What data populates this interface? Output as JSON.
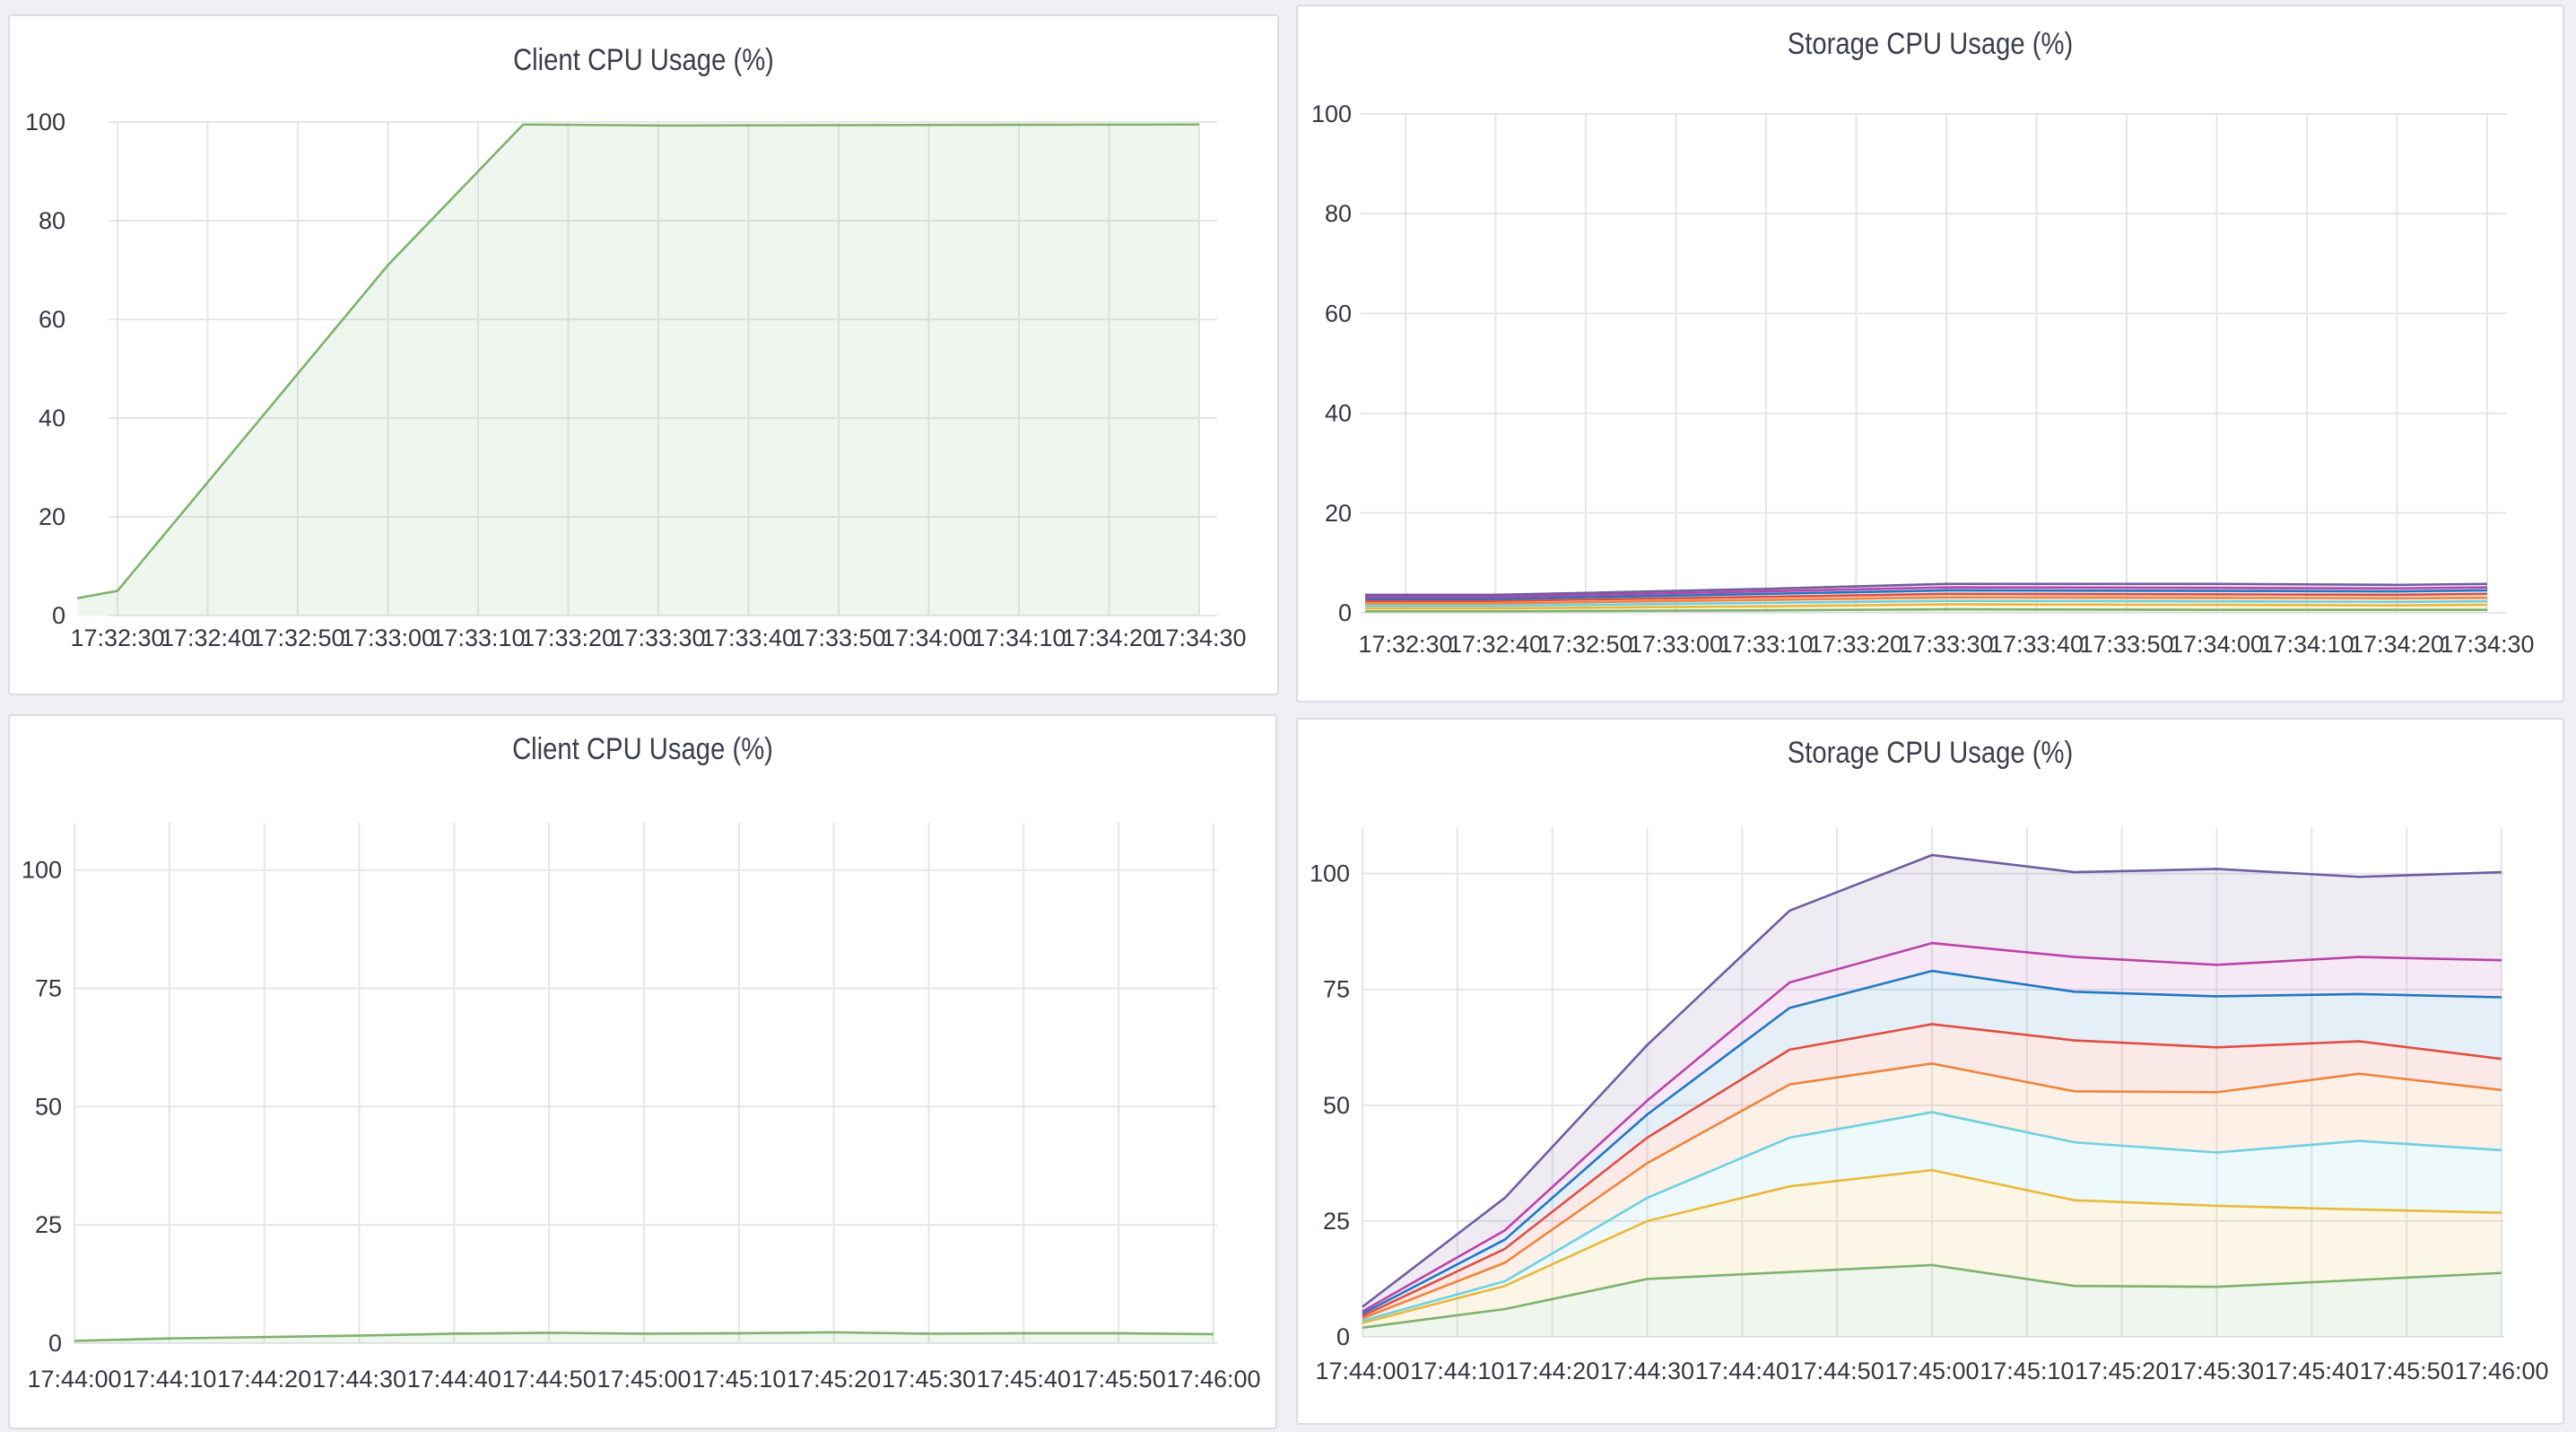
{
  "chart_data": [
    {
      "type": "area",
      "title": "Client CPU Usage (%)",
      "xlabel": "",
      "ylabel": "",
      "ylim": [
        0,
        100
      ],
      "y_ticks": [
        "0",
        "20",
        "40",
        "60",
        "80",
        "100"
      ],
      "x_ticks": [
        "17:32:30",
        "17:32:40",
        "17:32:50",
        "17:33:00",
        "17:33:10",
        "17:33:20",
        "17:33:30",
        "17:33:40",
        "17:33:50",
        "17:34:00",
        "17:34:10",
        "17:34:20",
        "17:34:30"
      ],
      "grid": true,
      "x": [
        "17:32:25",
        "17:32:30",
        "17:33:00",
        "17:33:15",
        "17:33:30",
        "17:34:30"
      ],
      "series": [
        {
          "values": [
            3.5,
            5,
            71,
            99.5,
            99.3,
            99.5
          ],
          "color": "#7eb26d"
        }
      ]
    },
    {
      "type": "area",
      "title": "Storage CPU Usage (%)",
      "xlabel": "",
      "ylabel": "",
      "ylim": [
        0,
        100
      ],
      "y_ticks": [
        "0",
        "20",
        "40",
        "60",
        "80",
        "100"
      ],
      "x_ticks": [
        "17:32:30",
        "17:32:40",
        "17:32:50",
        "17:33:00",
        "17:33:10",
        "17:33:20",
        "17:33:30",
        "17:33:40",
        "17:33:50",
        "17:34:00",
        "17:34:10",
        "17:34:20",
        "17:34:30"
      ],
      "grid": true,
      "x": [
        "17:32:25",
        "17:32:40",
        "17:33:10",
        "17:33:30",
        "17:34:00",
        "17:34:20",
        "17:34:30"
      ],
      "series": [
        {
          "values": [
            0.3,
            0.3,
            0.5,
            0.7,
            0.6,
            0.6,
            0.6
          ],
          "color": "#7eb26d"
        },
        {
          "values": [
            0.9,
            0.9,
            1.3,
            1.7,
            1.6,
            1.5,
            1.6
          ],
          "color": "#eab839"
        },
        {
          "values": [
            1.4,
            1.4,
            2.0,
            2.4,
            2.3,
            2.2,
            2.3
          ],
          "color": "#6ed0e0"
        },
        {
          "values": [
            1.9,
            1.9,
            2.6,
            3.1,
            3.0,
            2.9,
            3.0
          ],
          "color": "#ef843c"
        },
        {
          "values": [
            2.4,
            2.4,
            3.2,
            3.8,
            3.7,
            3.6,
            3.8
          ],
          "color": "#e24d42"
        },
        {
          "values": [
            2.8,
            2.8,
            3.8,
            4.5,
            4.4,
            4.3,
            4.5
          ],
          "color": "#1f78c1"
        },
        {
          "values": [
            3.2,
            3.2,
            4.3,
            5.1,
            5.0,
            4.9,
            5.1
          ],
          "color": "#ba43a9"
        },
        {
          "values": [
            3.6,
            3.6,
            4.8,
            5.8,
            5.8,
            5.6,
            5.8
          ],
          "color": "#705da0"
        }
      ]
    },
    {
      "type": "area",
      "title": "Client CPU Usage (%)",
      "xlabel": "",
      "ylabel": "",
      "ylim": [
        0,
        110
      ],
      "y_ticks": [
        "0",
        "25",
        "50",
        "75",
        "100"
      ],
      "x_ticks": [
        "17:44:00",
        "17:44:10",
        "17:44:20",
        "17:44:30",
        "17:44:40",
        "17:44:50",
        "17:45:00",
        "17:45:10",
        "17:45:20",
        "17:45:30",
        "17:45:40",
        "17:45:50",
        "17:46:00"
      ],
      "grid": true,
      "x": [
        "17:44:00",
        "17:44:10",
        "17:44:20",
        "17:44:30",
        "17:44:40",
        "17:44:50",
        "17:45:00",
        "17:45:10",
        "17:45:20",
        "17:45:30",
        "17:45:40",
        "17:45:50",
        "17:46:00"
      ],
      "series": [
        {
          "values": [
            0.5,
            1.0,
            1.3,
            1.6,
            2.0,
            2.2,
            2.0,
            2.1,
            2.3,
            2.0,
            2.1,
            2.1,
            1.9
          ],
          "color": "#7eb26d"
        }
      ]
    },
    {
      "type": "area",
      "title": "Storage CPU Usage (%)",
      "xlabel": "",
      "ylabel": "",
      "ylim": [
        0,
        110
      ],
      "y_ticks": [
        "0",
        "25",
        "50",
        "75",
        "100"
      ],
      "x_ticks": [
        "17:44:00",
        "17:44:10",
        "17:44:20",
        "17:44:30",
        "17:44:40",
        "17:44:50",
        "17:45:00",
        "17:45:10",
        "17:45:20",
        "17:45:30",
        "17:45:40",
        "17:45:50",
        "17:46:00"
      ],
      "grid": true,
      "x": [
        "17:44:00",
        "17:44:15",
        "17:44:30",
        "17:44:45",
        "17:45:00",
        "17:45:15",
        "17:45:30",
        "17:45:45",
        "17:46:00"
      ],
      "series": [
        {
          "values": [
            2,
            6,
            12.5,
            14,
            15.5,
            11,
            10.8,
            12.3,
            13.8
          ],
          "color": "#7eb26d"
        },
        {
          "values": [
            3,
            11,
            25,
            32.5,
            36,
            29.5,
            28.3,
            27.5,
            26.8
          ],
          "color": "#eab839"
        },
        {
          "values": [
            3.5,
            12,
            30,
            43,
            48.5,
            42,
            39.8,
            42.3,
            40.3
          ],
          "color": "#6ed0e0"
        },
        {
          "values": [
            4,
            16,
            37.5,
            54.5,
            59,
            53,
            52.8,
            56.8,
            53.3
          ],
          "color": "#ef843c"
        },
        {
          "values": [
            4.5,
            19,
            43,
            62,
            67.5,
            64,
            62.5,
            63.8,
            60
          ],
          "color": "#e24d42"
        },
        {
          "values": [
            5,
            21,
            48,
            71,
            79,
            74.5,
            73.5,
            74,
            73.3
          ],
          "color": "#1f78c1"
        },
        {
          "values": [
            5.5,
            23,
            51,
            76.5,
            85,
            82,
            80.3,
            82,
            81.3
          ],
          "color": "#ba43a9"
        },
        {
          "values": [
            6.5,
            30,
            63,
            92,
            104,
            100.3,
            101,
            99.3,
            100.3
          ],
          "color": "#705da0"
        }
      ]
    }
  ]
}
